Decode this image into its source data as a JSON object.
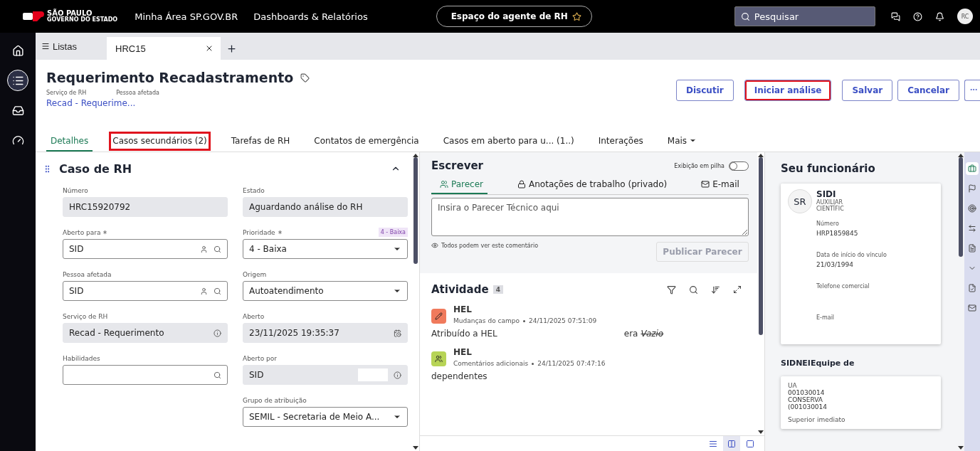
{
  "topbar": {
    "logo": {
      "title": "SÃO PAULO",
      "subtitle": "GOVERNO DO ESTADO"
    },
    "nav": [
      "Minha Área SP.GOV.BR",
      "Dashboards & Relatórios"
    ],
    "workspace": "Espaço do agente de RH",
    "search": {
      "placeholder": "Pesquisar"
    },
    "avatar": "RC"
  },
  "rail": [
    {
      "selected": false
    },
    {
      "selected": true
    },
    {
      "selected": false
    },
    {
      "selected": false
    }
  ],
  "tabstrip": {
    "lists": "Listas",
    "tabs": [
      {
        "label": "HRC15",
        "selected": true
      }
    ]
  },
  "header": {
    "title": "Requerimento Recadastramento",
    "meta_labels": [
      "Serviço de RH",
      "Pessoa afetada"
    ],
    "link": "Recad - Requerime...",
    "buttons": [
      {
        "label": "Discutir",
        "highlighted": false
      },
      {
        "label": "Iniciar análise",
        "highlighted": true
      },
      {
        "label": "Salvar",
        "highlighted": false
      },
      {
        "label": "Cancelar",
        "highlighted": false
      }
    ]
  },
  "tabs": [
    {
      "label": "Detalhes",
      "selected": true,
      "highlighted": false
    },
    {
      "label": "Casos secundários (2)",
      "selected": false,
      "highlighted": true
    },
    {
      "label": "Tarefas de RH",
      "selected": false,
      "highlighted": false
    },
    {
      "label": "Contatos de emergência",
      "selected": false,
      "highlighted": false
    },
    {
      "label": "Casos em aberto para u... (1..)",
      "selected": false,
      "highlighted": false
    },
    {
      "label": "Interações",
      "selected": false,
      "highlighted": false
    },
    {
      "label": "Mais",
      "selected": false,
      "highlighted": false,
      "kind": "menu"
    }
  ],
  "form": {
    "title": "Caso de RH",
    "columns": [
      [
        {
          "label": "Número",
          "kind": "readonly",
          "value": "HRC15920792"
        },
        {
          "label": "Aberto para",
          "required": true,
          "kind": "reference",
          "value": "SID"
        },
        {
          "label": "Pessoa afetada",
          "kind": "reference",
          "value": "SID"
        },
        {
          "label": "Serviço de RH",
          "kind": "readonly-info",
          "value": "Recad - Requerimento"
        },
        {
          "label": "Habilidades",
          "kind": "lookup"
        }
      ],
      [
        {
          "label": "Estado",
          "kind": "readonly",
          "value": "Aguardando análise do RH"
        },
        {
          "label": "Prioridade",
          "required": true,
          "kind": "select",
          "value": "4 - Baixa",
          "badge": "4 - Baixa"
        },
        {
          "label": "Origem",
          "kind": "select",
          "value": "Autoatendimento"
        },
        {
          "label": "Aberto",
          "kind": "readonly-date",
          "value": "23/11/2025 19:35:37"
        },
        {
          "label": "Aberto por",
          "kind": "readonly-info",
          "value": "SID"
        },
        {
          "label": "Grupo de atribuição",
          "kind": "select",
          "value": "SEMIL - Secretaria de Meio A..."
        }
      ]
    ]
  },
  "compose": {
    "title": "Escrever",
    "toggle": {
      "label": "Exibição em pilha",
      "on": false
    },
    "tabs": [
      {
        "label": "Parecer",
        "selected": true
      },
      {
        "label": "Anotações de trabalho (privado)",
        "selected": false
      },
      {
        "label": "E-mail",
        "selected": false
      }
    ],
    "placeholder": "Insira o Parecer Técnico aqui",
    "note": "Todos podem ver este comentário",
    "button": {
      "label": "Publicar Parecer",
      "disabled": true
    }
  },
  "activity": {
    "title": "Atividade",
    "count": "4",
    "entries": [
      {
        "author": "HEL",
        "type": "Mudanças do campo",
        "time": "24/11/2025 07:51:09",
        "color": "#f07a5c",
        "body": "Atribuído a  HEL",
        "was": "era",
        "old": "Vazio"
      },
      {
        "author": "HEL",
        "type": "Comentários adicionais",
        "time": "24/11/2025 07:47:16",
        "color": "#b7d456",
        "body": "dependentes"
      }
    ]
  },
  "views": [
    {
      "selected": false
    },
    {
      "selected": true
    },
    {
      "selected": false
    }
  ],
  "employee": {
    "title": "Seu funcionário",
    "initials": "SR",
    "name": "SIDI",
    "job": [
      "AUXILIAR",
      "CIENTÍFIC"
    ],
    "fields": [
      {
        "label": "Número",
        "value": "HRP1859845"
      },
      {
        "label": "Data de início do vínculo",
        "value": "21/03/1994"
      },
      {
        "label": "Telefone comercial"
      },
      {
        "label": "E-mail"
      }
    ]
  },
  "team": {
    "title": "SIDNEIEquipe de",
    "label": "UA",
    "lines": [
      "001030014",
      "CONSERVA",
      "(001030014"
    ],
    "next_label": "Superior imediato"
  },
  "side_icons": [
    {
      "selected": true
    },
    {
      "selected": false
    },
    {
      "selected": false
    },
    {
      "selected": false
    },
    {
      "selected": false
    },
    {
      "selected": false
    },
    {
      "selected": false
    },
    {
      "selected": false
    }
  ]
}
